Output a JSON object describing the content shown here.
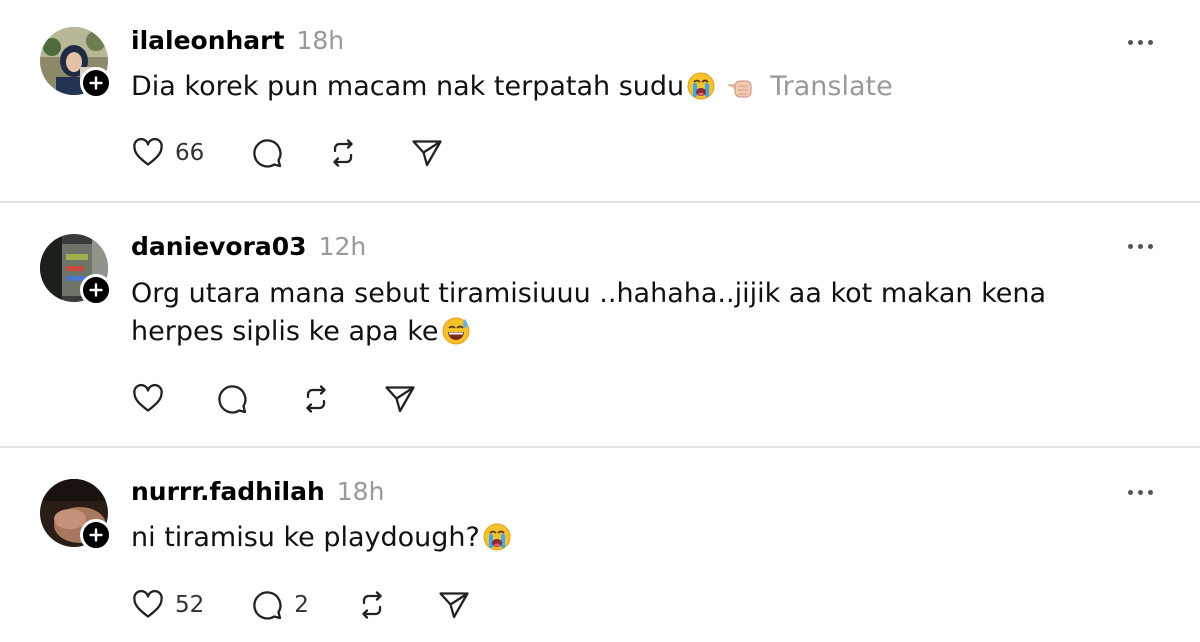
{
  "posts": [
    {
      "username": "ilaleonhart",
      "time": "18h",
      "text": "Dia korek pun macam nak terpatah sudu",
      "translate_label": "Translate",
      "likes": "66",
      "replies": ""
    },
    {
      "username": "danievora03",
      "time": "12h",
      "text": "Org utara mana sebut tiramisiuuu ..hahaha..jijik aa kot makan kena herpes siplis ke apa ke",
      "likes": "",
      "replies": ""
    },
    {
      "username": "nurrr.fadhilah",
      "time": "18h",
      "text": "ni tiramisu ke playdough?",
      "likes": "52",
      "replies": "2"
    }
  ],
  "icons": {
    "like": "heart-icon",
    "reply": "comment-icon",
    "repost": "repost-icon",
    "share": "send-icon",
    "more": "more-icon",
    "follow": "plus-icon"
  },
  "colors": {
    "text": "#000000",
    "muted": "#999999",
    "divider": "#e3e3e3",
    "background": "#ffffff"
  }
}
